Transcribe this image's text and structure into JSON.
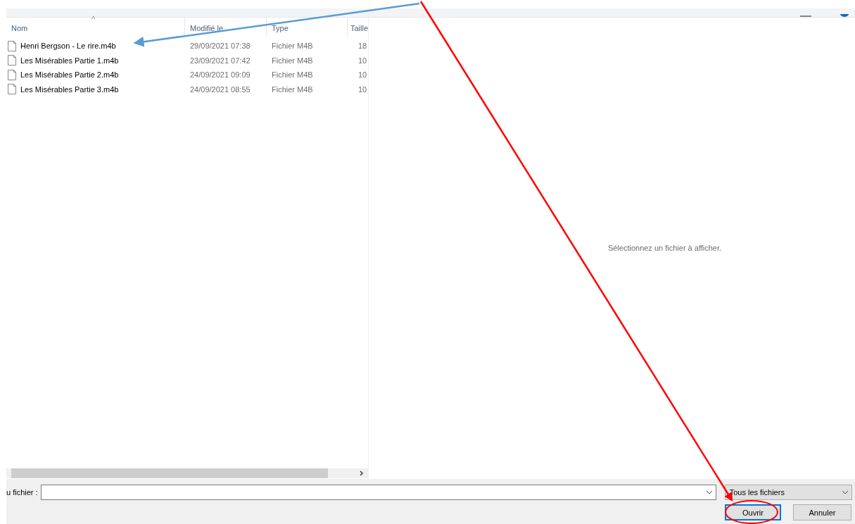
{
  "file_list": {
    "sort_indicator": "^",
    "columns": [
      "Nom",
      "Modifié le",
      "Type",
      "Taille"
    ],
    "rows": [
      {
        "name": "Henri Bergson - Le rire.m4b",
        "modified": "29/09/2021 07:38",
        "type": "Fichier M4B",
        "size": "18"
      },
      {
        "name": "Les Misérables Partie 1.m4b",
        "modified": "23/09/2021 07:42",
        "type": "Fichier M4B",
        "size": "10"
      },
      {
        "name": "Les Misérables Partie 2.m4b",
        "modified": "24/09/2021 09:09",
        "type": "Fichier M4B",
        "size": "10"
      },
      {
        "name": "Les Misérables Partie 3.m4b",
        "modified": "24/09/2021 08:55",
        "type": "Fichier M4B",
        "size": "10"
      }
    ]
  },
  "preview": {
    "message": "Sélectionnez un fichier à afficher."
  },
  "footer": {
    "filename_label": "u fichier :",
    "filter": "Tous les fichiers",
    "buttons": [
      {
        "label": "Ouvrir",
        "default": true
      },
      {
        "label": "Annuler",
        "default": false
      }
    ]
  }
}
